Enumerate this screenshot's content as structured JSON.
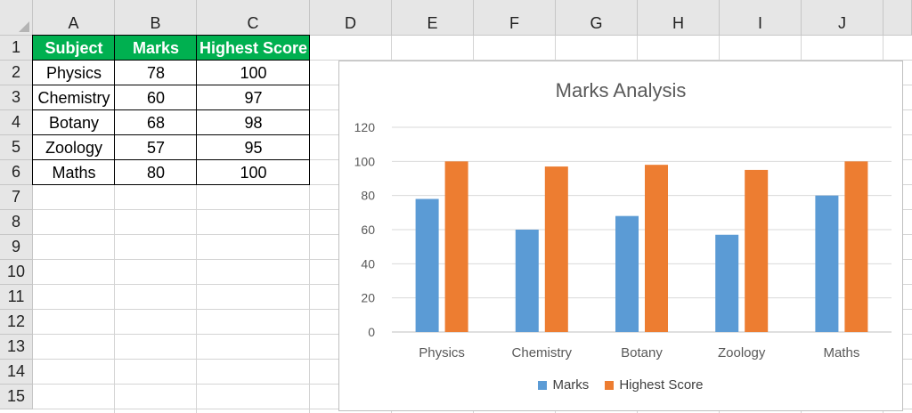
{
  "sheet": {
    "columns": [
      "A",
      "B",
      "C",
      "D",
      "E",
      "F",
      "G",
      "H",
      "I",
      "J"
    ],
    "rows": [
      "1",
      "2",
      "3",
      "4",
      "5",
      "6",
      "7",
      "8",
      "9",
      "10",
      "11",
      "12",
      "13",
      "14",
      "15"
    ]
  },
  "table": {
    "headers": [
      "Subject",
      "Marks",
      "Highest Score"
    ],
    "rows": [
      [
        "Physics",
        "78",
        "100"
      ],
      [
        "Chemistry",
        "60",
        "97"
      ],
      [
        "Botany",
        "68",
        "98"
      ],
      [
        "Zoology",
        "57",
        "95"
      ],
      [
        "Maths",
        "80",
        "100"
      ]
    ],
    "header_color": "#00b050"
  },
  "chart_data": {
    "type": "bar",
    "title": "Marks Analysis",
    "categories": [
      "Physics",
      "Chemistry",
      "Botany",
      "Zoology",
      "Maths"
    ],
    "series": [
      {
        "name": "Marks",
        "values": [
          78,
          60,
          68,
          57,
          80
        ],
        "color": "#5b9bd5"
      },
      {
        "name": "Highest Score",
        "values": [
          100,
          97,
          98,
          95,
          100
        ],
        "color": "#ed7d31"
      }
    ],
    "ylim": [
      0,
      120
    ],
    "yticks": [
      "0",
      "20",
      "40",
      "60",
      "80",
      "100",
      "120"
    ],
    "grid": true,
    "legend": "bottom"
  }
}
